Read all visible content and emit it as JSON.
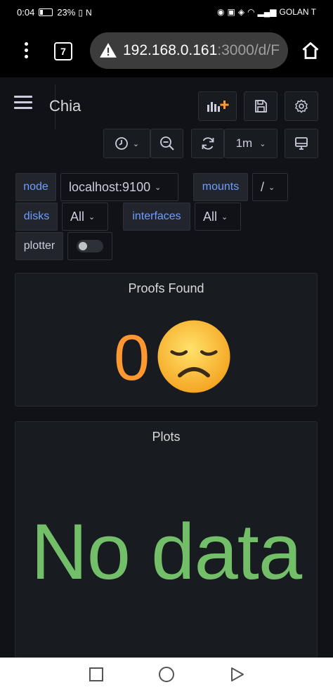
{
  "statusbar": {
    "time": "0:04",
    "battery": "23%",
    "carrier": "GOLAN T"
  },
  "browser": {
    "tab_count": "7",
    "url_host": "192.168.0.161",
    "url_rest": ":3000/d/F"
  },
  "dashboard": {
    "title": "Chia",
    "refresh_interval": "1m"
  },
  "variables": {
    "node_label": "node",
    "node_value": "localhost:9100",
    "mounts_label": "mounts",
    "mounts_value": "/",
    "disks_label": "disks",
    "disks_value": "All",
    "interfaces_label": "interfaces",
    "interfaces_value": "All",
    "plotter_label": "plotter"
  },
  "panels": {
    "proofs_title": "Proofs Found",
    "proofs_value": "0",
    "plots_title": "Plots",
    "plots_value": "No data"
  },
  "colors": {
    "proofs_value": "#ff9830",
    "plots_value": "#73bf69",
    "variable_label": "#6e9fff"
  }
}
